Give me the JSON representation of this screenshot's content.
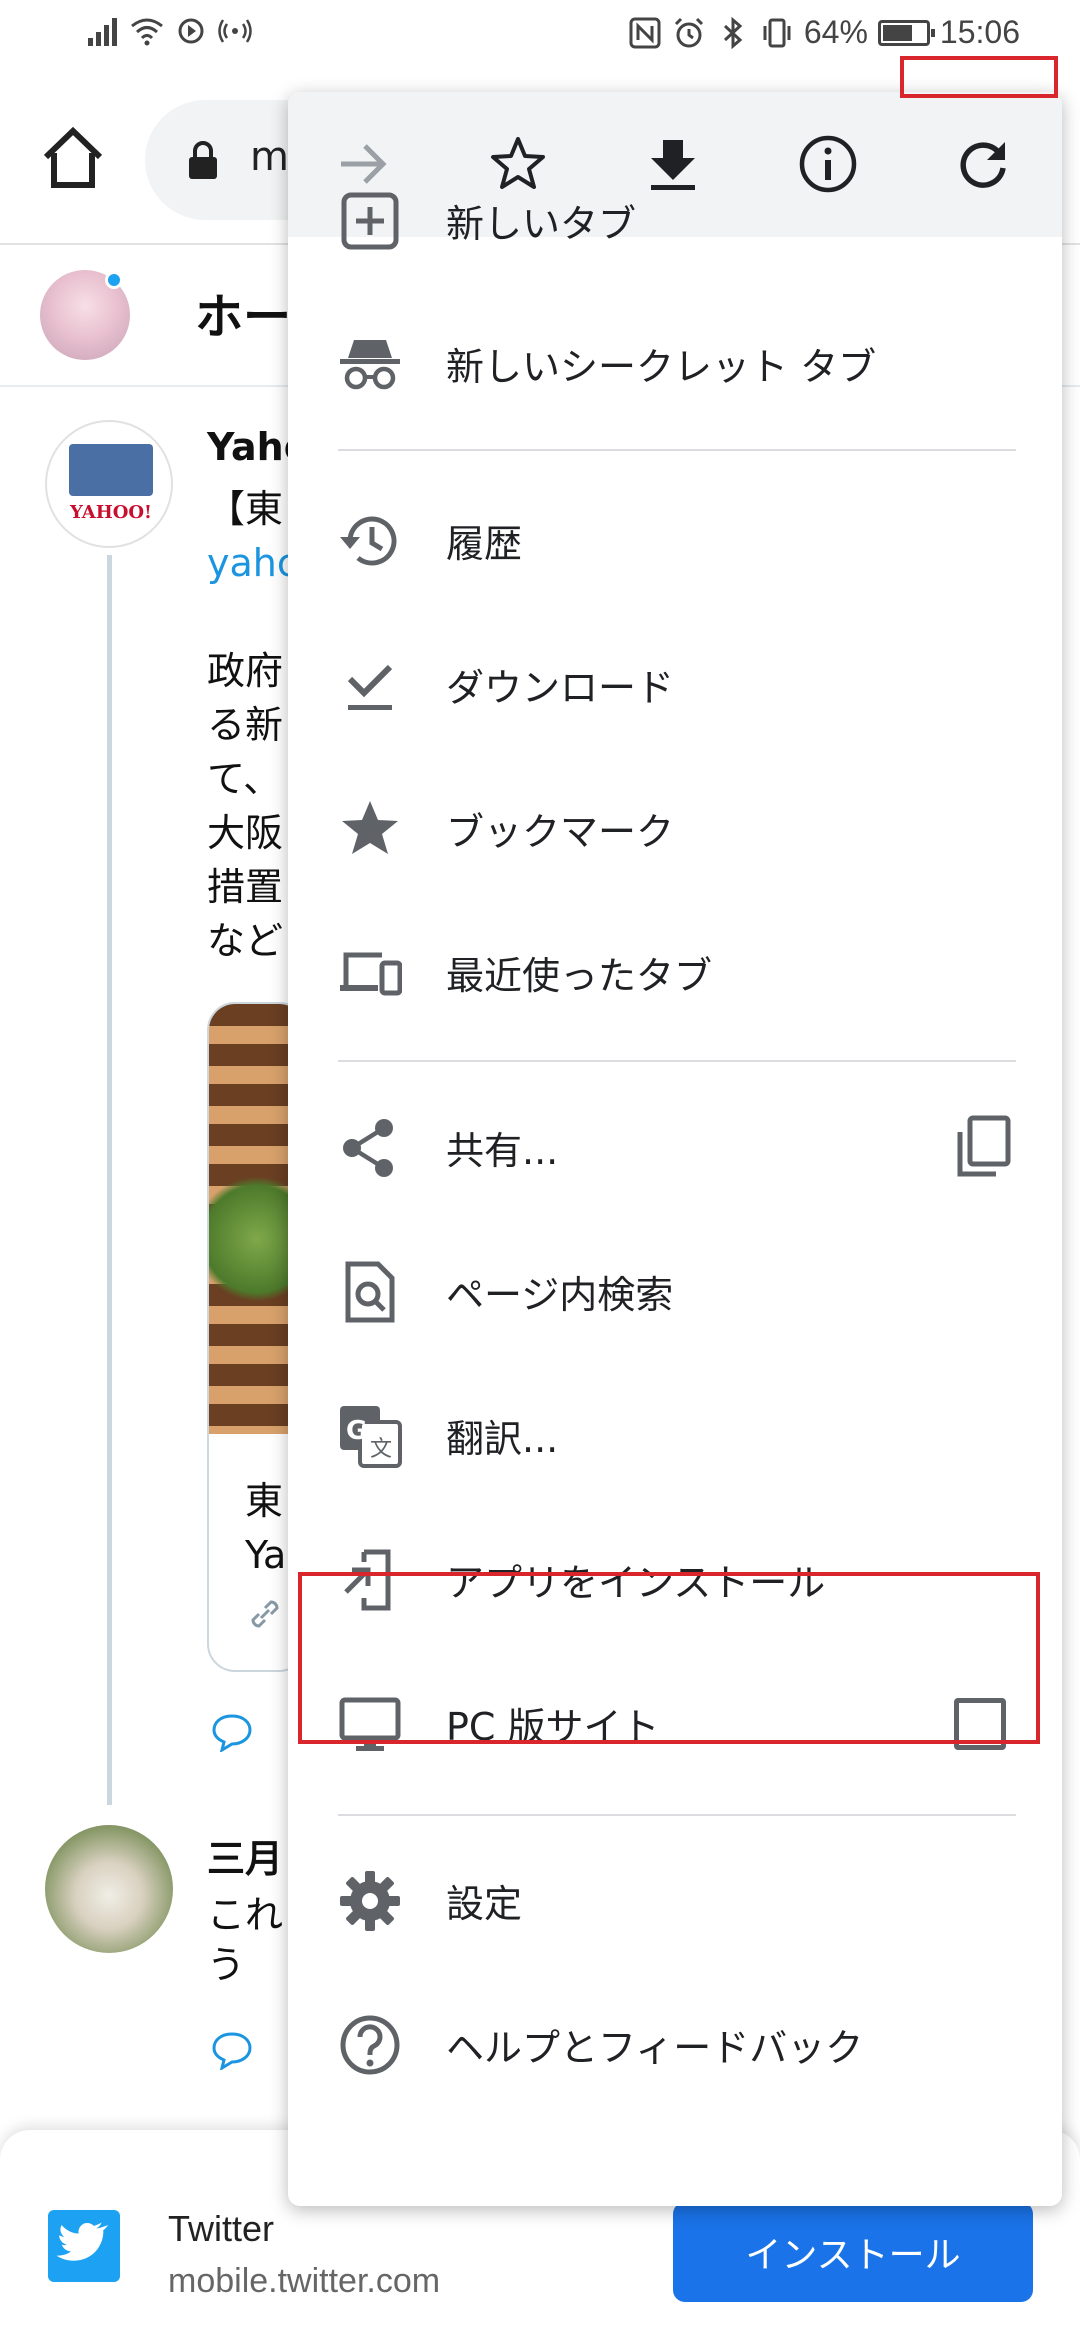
{
  "status_bar": {
    "battery": "64%",
    "time": "15:06"
  },
  "browser": {
    "url_partial": "m"
  },
  "page": {
    "header_title": "ホー",
    "tweet1": {
      "name": "Yaho",
      "line1": "【東",
      "link": "yahc",
      "body_lines": [
        "政府",
        "る新",
        "て、",
        "大阪",
        "措置",
        "など"
      ],
      "card_lines": [
        "東",
        "Ya"
      ]
    },
    "tweet2": {
      "name": "三月",
      "body_lines": [
        "これ",
        "う"
      ]
    }
  },
  "menu": {
    "top_icons": [
      "forward-arrow-icon",
      "star-icon",
      "download-icon",
      "info-icon",
      "refresh-icon"
    ],
    "items": [
      {
        "label": "新しいタブ",
        "icon": "new-tab-icon"
      },
      {
        "label": "新しいシークレット タブ",
        "icon": "incognito-icon"
      },
      {
        "label": "履歴",
        "icon": "history-icon"
      },
      {
        "label": "ダウンロード",
        "icon": "downloads-icon"
      },
      {
        "label": "ブックマーク",
        "icon": "bookmark-star-icon"
      },
      {
        "label": "最近使ったタブ",
        "icon": "recent-tabs-icon"
      },
      {
        "label": "共有...",
        "icon": "share-icon"
      },
      {
        "label": "ページ内検索",
        "icon": "find-in-page-icon"
      },
      {
        "label": "翻訳...",
        "icon": "translate-icon"
      },
      {
        "label": "アプリをインストール",
        "icon": "install-app-icon"
      },
      {
        "label": "PC 版サイト",
        "icon": "desktop-icon",
        "checked": false
      },
      {
        "label": "設定",
        "icon": "settings-gear-icon"
      },
      {
        "label": "ヘルプとフィードバック",
        "icon": "help-icon"
      }
    ]
  },
  "install_banner": {
    "app_name": "Twitter",
    "url": "mobile.twitter.com",
    "install_label": "インストール"
  },
  "colors": {
    "highlight": "#d9252c",
    "menu_icon": "#5f6368",
    "install_button": "#1a73e8",
    "twitter_blue": "#1da1f2"
  }
}
